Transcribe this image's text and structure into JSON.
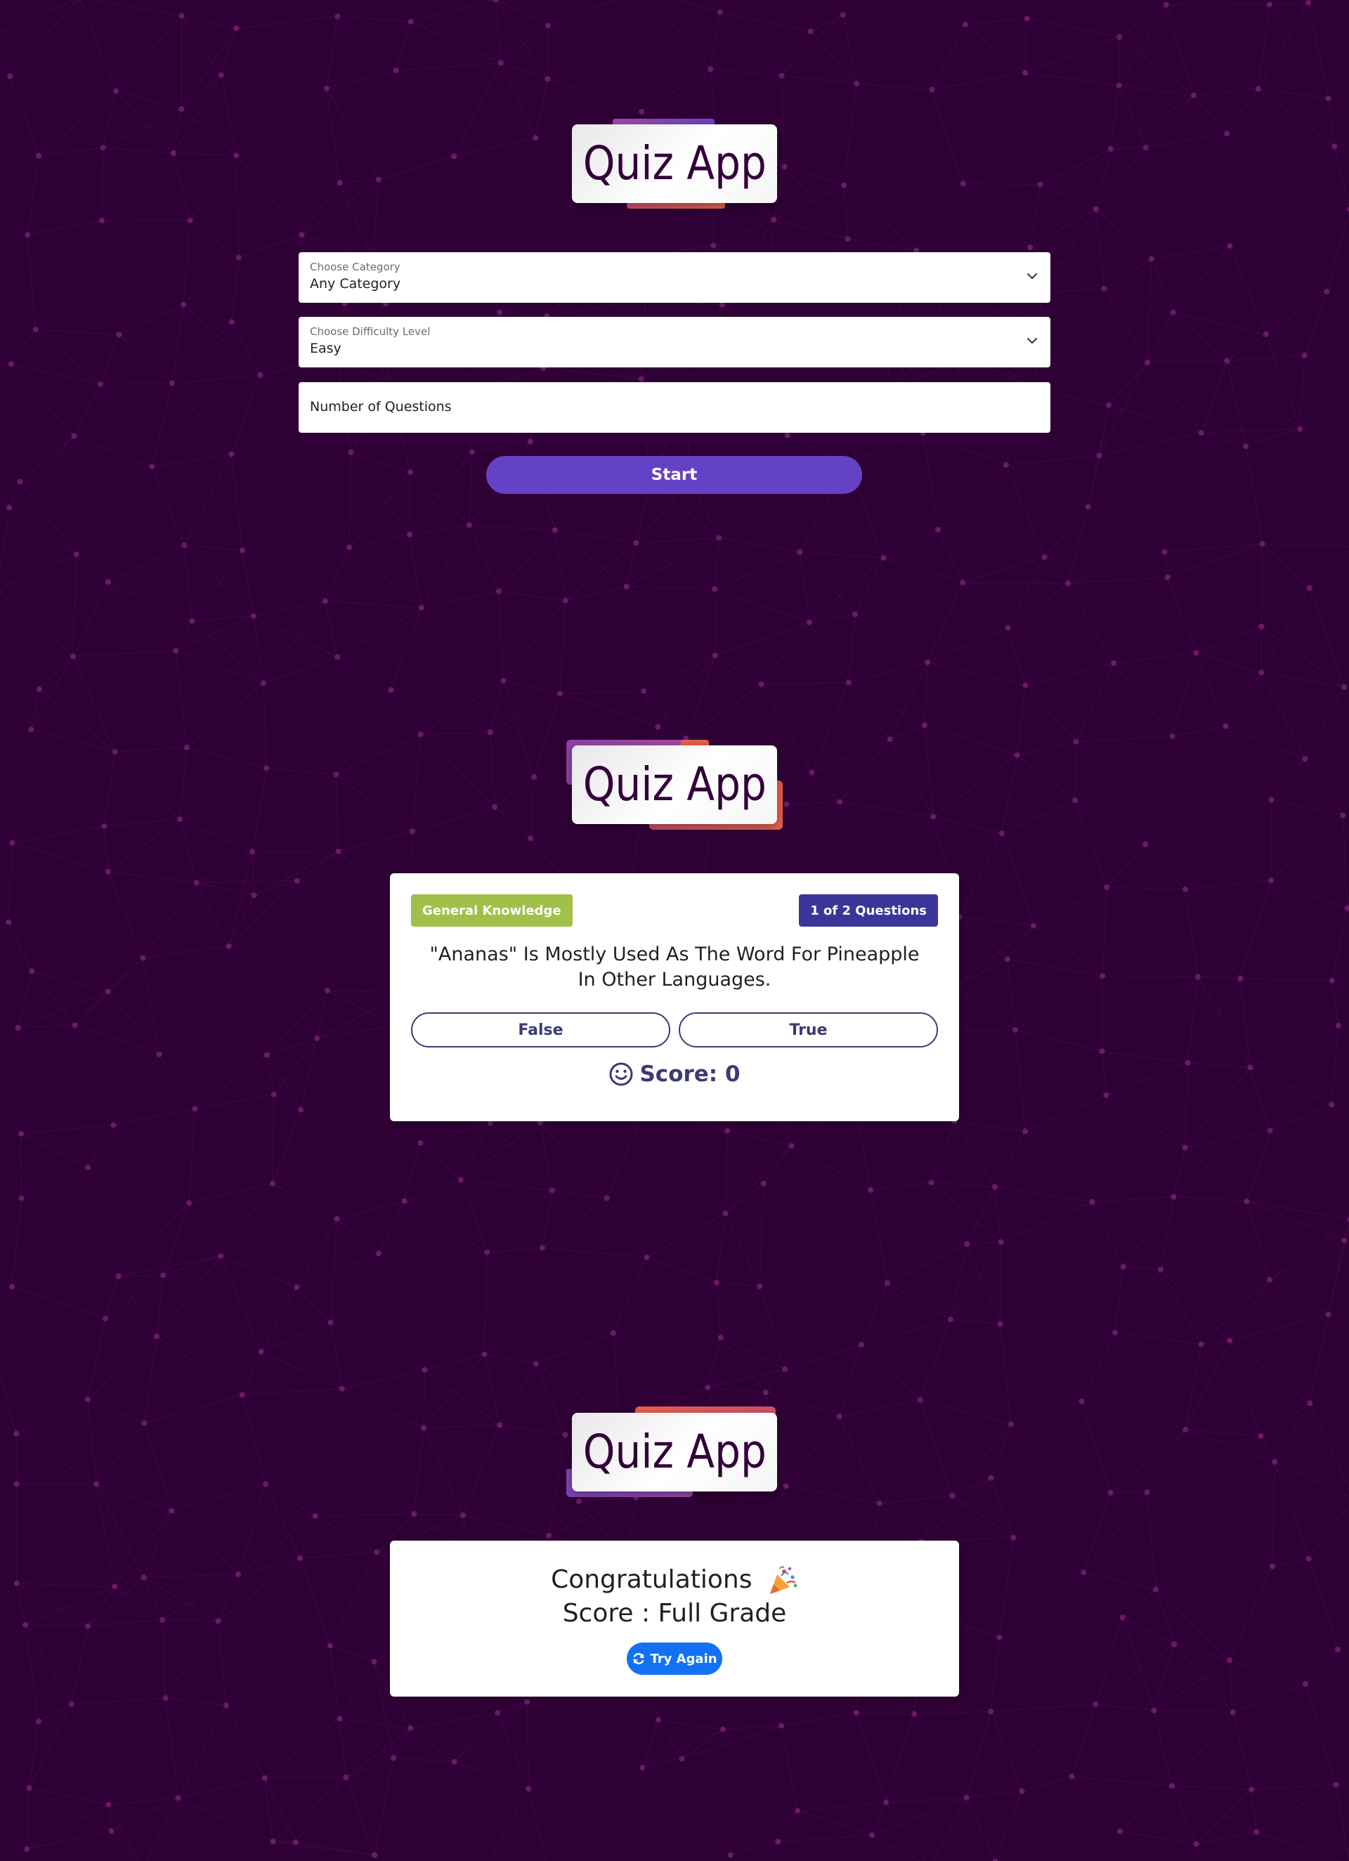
{
  "app": {
    "title": "Quiz App"
  },
  "setup": {
    "category": {
      "label": "Choose Category",
      "value": "Any Category"
    },
    "difficulty": {
      "label": "Choose Difficulty Level",
      "value": "Easy"
    },
    "questions": {
      "placeholder": "Number of Questions"
    },
    "start_label": "Start"
  },
  "quiz": {
    "category_badge": "General Knowledge",
    "progress_badge": "1 of 2 Questions",
    "question": "\"Ananas\" Is Mostly Used As The Word For Pineapple In Other Languages.",
    "answers": [
      "False",
      "True"
    ],
    "score_label": "Score: 0"
  },
  "result": {
    "congrats": "Congratulations",
    "score": "Score : Full Grade",
    "try_again_label": "Try Again"
  },
  "icons": {
    "select_arrow": "chevron-down-icon",
    "score": "smile-icon",
    "celebration": "party-popper-icon",
    "retry": "refresh-icon"
  },
  "colors": {
    "background": "#2f0035",
    "primary": "#6442c6",
    "category_badge": "#9fc14a",
    "progress_badge": "#3a3598",
    "answer_outline": "#3b3a74",
    "try_again": "#1372f4",
    "logo_text": "#33003a"
  }
}
